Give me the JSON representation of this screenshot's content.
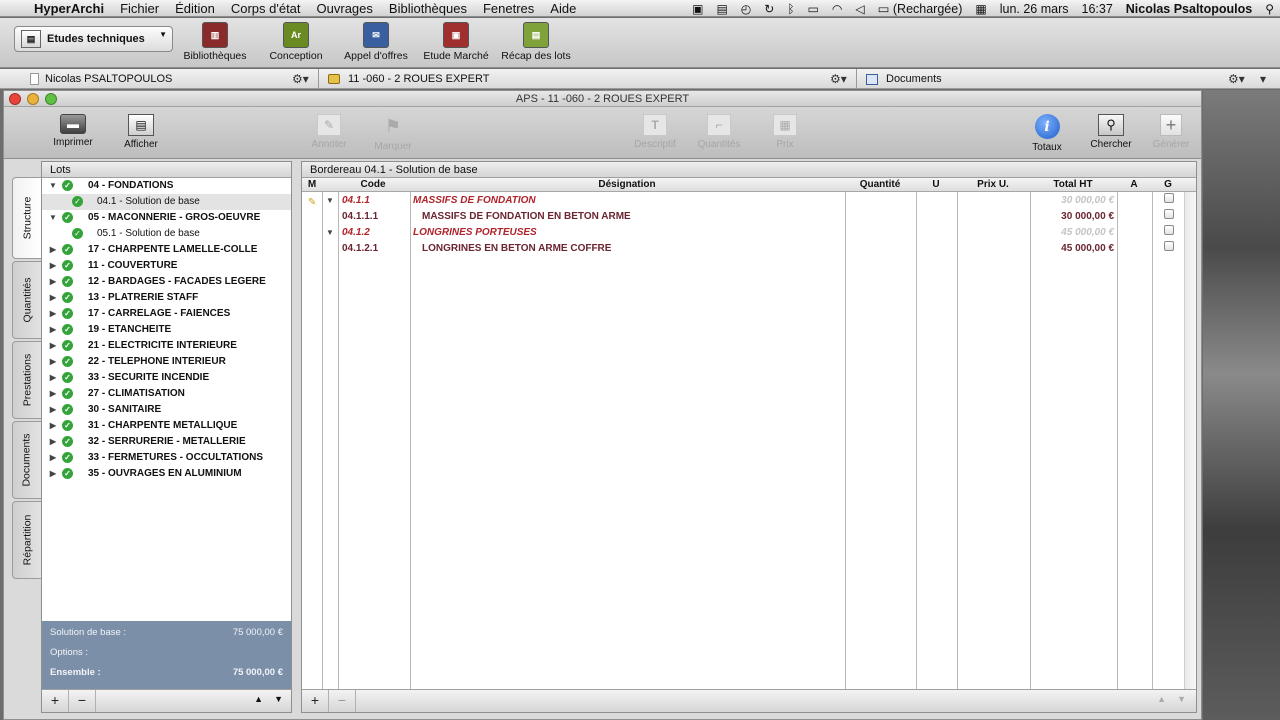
{
  "menubar": {
    "apple": "",
    "app": "HyperArchi",
    "items": [
      "Fichier",
      "Édition",
      "Corps d'état",
      "Ouvrages",
      "Bibliothèques",
      "Fenetres",
      "Aide"
    ],
    "battery": "(Rechargée)",
    "date": "lun. 26 mars",
    "time": "16:37",
    "user": "Nicolas Psaltopoulos"
  },
  "apptoolbar": {
    "module": "Etudes techniques",
    "nav": [
      {
        "label": "Bibliothèques",
        "color": "#8b2a2a"
      },
      {
        "label": "Conception",
        "color": "#6a8a22"
      },
      {
        "label": "Appel d'offres",
        "color": "#3a5fa0"
      },
      {
        "label": "Etude Marché",
        "color": "#a02f2f"
      },
      {
        "label": "Récap des lots",
        "color": "#7fa23a"
      }
    ]
  },
  "infobar": {
    "user": "Nicolas PSALTOPOULOS",
    "project": "11 -060 - 2 ROUES EXPERT",
    "documents": "Documents"
  },
  "window": {
    "title": "APS - 11 -060 - 2 ROUES EXPERT",
    "toolbar": {
      "print": "Imprimer",
      "view": "Afficher",
      "annotate": "Annoter",
      "mark": "Marquer",
      "descriptif": "Descriptif",
      "quantites": "Quantités",
      "prix": "Prix",
      "totaux": "Totaux",
      "chercher": "Chercher",
      "generer": "Générer"
    }
  },
  "sidetabs": [
    "Structure",
    "Quantités",
    "Prestations",
    "Documents",
    "Répartition"
  ],
  "lots": {
    "title": "Lots",
    "items": [
      {
        "label": "04 - FONDATIONS",
        "sub": false,
        "expanded": true
      },
      {
        "label": "04.1 - Solution de base",
        "sub": true,
        "selected": true
      },
      {
        "label": "05 - MACONNERIE - GROS-OEUVRE",
        "sub": false,
        "expanded": true
      },
      {
        "label": "05.1 - Solution de base",
        "sub": true
      },
      {
        "label": "17 - CHARPENTE LAMELLE-COLLE",
        "sub": false
      },
      {
        "label": "11 - COUVERTURE",
        "sub": false
      },
      {
        "label": "12 - BARDAGES - FACADES LEGERE",
        "sub": false
      },
      {
        "label": "13 - PLATRERIE  STAFF",
        "sub": false
      },
      {
        "label": "17 - CARRELAGE - FAIENCES",
        "sub": false
      },
      {
        "label": "19 - ETANCHEITE",
        "sub": false
      },
      {
        "label": "21 - ELECTRICITE INTERIEURE",
        "sub": false
      },
      {
        "label": "22 - TELEPHONE INTERIEUR",
        "sub": false
      },
      {
        "label": "33 - SECURITE INCENDIE",
        "sub": false
      },
      {
        "label": "27 - CLIMATISATION",
        "sub": false
      },
      {
        "label": "30 - SANITAIRE",
        "sub": false
      },
      {
        "label": "31 - CHARPENTE METALLIQUE",
        "sub": false
      },
      {
        "label": "32 - SERRURERIE - METALLERIE",
        "sub": false
      },
      {
        "label": "33 - FERMETURES - OCCULTATIONS",
        "sub": false
      },
      {
        "label": "35 - OUVRAGES EN ALUMINIUM",
        "sub": false
      }
    ],
    "summary": {
      "base_label": "Solution de base :",
      "base_value": "75 000,00 €",
      "options_label": "Options :",
      "options_value": "",
      "total_label": "Ensemble :",
      "total_value": "75 000,00 €"
    }
  },
  "bordereau": {
    "title": "Bordereau 04.1 - Solution de base",
    "columns": {
      "m": "M",
      "code": "Code",
      "designation": "Désignation",
      "quantite": "Quantité",
      "u": "U",
      "prix": "Prix U.",
      "total": "Total HT",
      "a": "A",
      "g": "G"
    },
    "rows": [
      {
        "type": "grp",
        "code": "04.1.1",
        "designation": "MASSIFS DE FONDATION",
        "total": "30 000,00 €"
      },
      {
        "type": "item",
        "code": "04.1.1.1",
        "designation": "MASSIFS DE FONDATION EN BETON ARME",
        "total": "30 000,00 €"
      },
      {
        "type": "grp",
        "code": "04.1.2",
        "designation": "LONGRINES PORTEUSES",
        "total": "45 000,00 €"
      },
      {
        "type": "item",
        "code": "04.1.2.1",
        "designation": "LONGRINES EN BETON ARME COFFRE",
        "total": "45 000,00 €"
      }
    ]
  }
}
